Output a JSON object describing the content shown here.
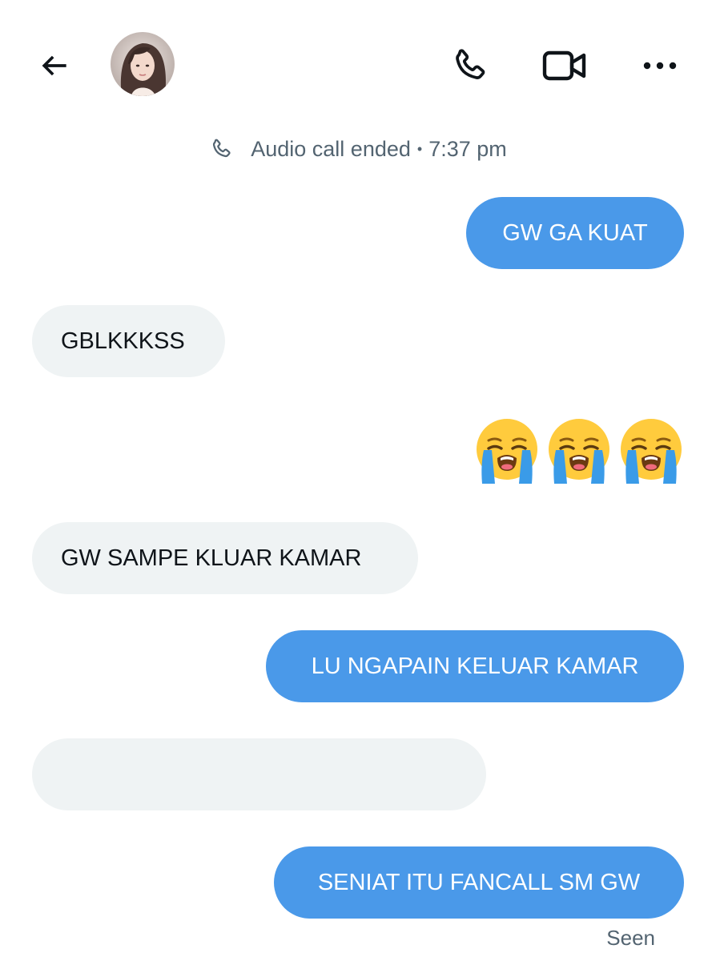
{
  "header": {
    "back_icon": "arrow-left-icon",
    "avatar": "profile-photo",
    "call_icon": "phone-icon",
    "video_icon": "video-camera-icon",
    "more_icon": "more-horizontal-icon"
  },
  "call_notice": {
    "icon": "phone-icon",
    "text": "Audio call ended",
    "separator": "•",
    "time": "7:37 pm"
  },
  "messages": [
    {
      "direction": "out",
      "text": "GW GA KUAT"
    },
    {
      "direction": "in",
      "text": "GBLKKKSS"
    },
    {
      "direction": "out",
      "emoji": "loudly-crying-face",
      "count": 3
    },
    {
      "direction": "in",
      "text": "GW SAMPE KLUAR KAMAR"
    },
    {
      "direction": "out",
      "text": "LU NGAPAIN KELUAR KAMAR"
    },
    {
      "direction": "in",
      "text": ""
    },
    {
      "direction": "out",
      "text": "SENIAT ITU FANCALL SM GW"
    }
  ],
  "status": {
    "seen_label": "Seen"
  },
  "colors": {
    "outgoing_bubble": "#4a99e9",
    "incoming_bubble": "#eff3f4",
    "secondary_text": "#536471"
  }
}
